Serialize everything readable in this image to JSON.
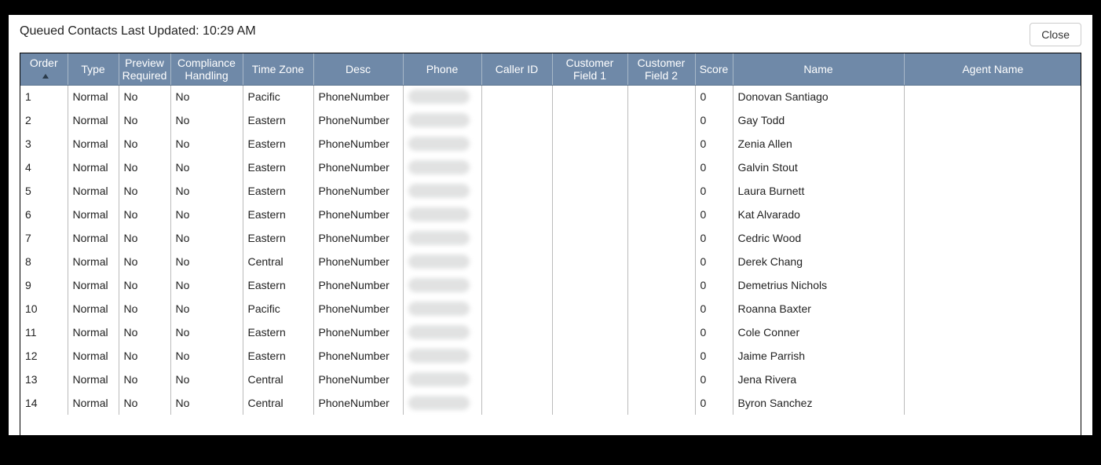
{
  "header": {
    "title": "Queued Contacts Last Updated: 10:29 AM",
    "close_label": "Close"
  },
  "columns": {
    "order": "Order",
    "type": "Type",
    "preview_required": "Preview Required",
    "compliance_handling": "Compliance Handling",
    "time_zone": "Time Zone",
    "desc": "Desc",
    "phone": "Phone",
    "caller_id": "Caller ID",
    "customer_field_1": "Customer Field 1",
    "customer_field_2": "Customer Field 2",
    "score": "Score",
    "name": "Name",
    "agent_name": "Agent Name"
  },
  "sort": {
    "column": "order",
    "direction": "asc"
  },
  "rows": [
    {
      "order": "1",
      "type": "Normal",
      "preview_required": "No",
      "compliance_handling": "No",
      "time_zone": "Pacific",
      "desc": "PhoneNumber",
      "phone": "",
      "caller_id": "",
      "cf1": "",
      "cf2": "",
      "score": "0",
      "name": "Donovan Santiago",
      "agent_name": ""
    },
    {
      "order": "2",
      "type": "Normal",
      "preview_required": "No",
      "compliance_handling": "No",
      "time_zone": "Eastern",
      "desc": "PhoneNumber",
      "phone": "",
      "caller_id": "",
      "cf1": "",
      "cf2": "",
      "score": "0",
      "name": "Gay Todd",
      "agent_name": ""
    },
    {
      "order": "3",
      "type": "Normal",
      "preview_required": "No",
      "compliance_handling": "No",
      "time_zone": "Eastern",
      "desc": "PhoneNumber",
      "phone": "",
      "caller_id": "",
      "cf1": "",
      "cf2": "",
      "score": "0",
      "name": "Zenia Allen",
      "agent_name": ""
    },
    {
      "order": "4",
      "type": "Normal",
      "preview_required": "No",
      "compliance_handling": "No",
      "time_zone": "Eastern",
      "desc": "PhoneNumber",
      "phone": "",
      "caller_id": "",
      "cf1": "",
      "cf2": "",
      "score": "0",
      "name": "Galvin Stout",
      "agent_name": ""
    },
    {
      "order": "5",
      "type": "Normal",
      "preview_required": "No",
      "compliance_handling": "No",
      "time_zone": "Eastern",
      "desc": "PhoneNumber",
      "phone": "",
      "caller_id": "",
      "cf1": "",
      "cf2": "",
      "score": "0",
      "name": "Laura Burnett",
      "agent_name": ""
    },
    {
      "order": "6",
      "type": "Normal",
      "preview_required": "No",
      "compliance_handling": "No",
      "time_zone": "Eastern",
      "desc": "PhoneNumber",
      "phone": "",
      "caller_id": "",
      "cf1": "",
      "cf2": "",
      "score": "0",
      "name": "Kat Alvarado",
      "agent_name": ""
    },
    {
      "order": "7",
      "type": "Normal",
      "preview_required": "No",
      "compliance_handling": "No",
      "time_zone": "Eastern",
      "desc": "PhoneNumber",
      "phone": "",
      "caller_id": "",
      "cf1": "",
      "cf2": "",
      "score": "0",
      "name": "Cedric Wood",
      "agent_name": ""
    },
    {
      "order": "8",
      "type": "Normal",
      "preview_required": "No",
      "compliance_handling": "No",
      "time_zone": "Central",
      "desc": "PhoneNumber",
      "phone": "",
      "caller_id": "",
      "cf1": "",
      "cf2": "",
      "score": "0",
      "name": "Derek Chang",
      "agent_name": ""
    },
    {
      "order": "9",
      "type": "Normal",
      "preview_required": "No",
      "compliance_handling": "No",
      "time_zone": "Eastern",
      "desc": "PhoneNumber",
      "phone": "",
      "caller_id": "",
      "cf1": "",
      "cf2": "",
      "score": "0",
      "name": "Demetrius Nichols",
      "agent_name": ""
    },
    {
      "order": "10",
      "type": "Normal",
      "preview_required": "No",
      "compliance_handling": "No",
      "time_zone": "Pacific",
      "desc": "PhoneNumber",
      "phone": "",
      "caller_id": "",
      "cf1": "",
      "cf2": "",
      "score": "0",
      "name": "Roanna Baxter",
      "agent_name": ""
    },
    {
      "order": "11",
      "type": "Normal",
      "preview_required": "No",
      "compliance_handling": "No",
      "time_zone": "Eastern",
      "desc": "PhoneNumber",
      "phone": "",
      "caller_id": "",
      "cf1": "",
      "cf2": "",
      "score": "0",
      "name": "Cole Conner",
      "agent_name": ""
    },
    {
      "order": "12",
      "type": "Normal",
      "preview_required": "No",
      "compliance_handling": "No",
      "time_zone": "Eastern",
      "desc": "PhoneNumber",
      "phone": "",
      "caller_id": "",
      "cf1": "",
      "cf2": "",
      "score": "0",
      "name": "Jaime Parrish",
      "agent_name": ""
    },
    {
      "order": "13",
      "type": "Normal",
      "preview_required": "No",
      "compliance_handling": "No",
      "time_zone": "Central",
      "desc": "PhoneNumber",
      "phone": "",
      "caller_id": "",
      "cf1": "",
      "cf2": "",
      "score": "0",
      "name": "Jena Rivera",
      "agent_name": ""
    },
    {
      "order": "14",
      "type": "Normal",
      "preview_required": "No",
      "compliance_handling": "No",
      "time_zone": "Central",
      "desc": "PhoneNumber",
      "phone": "",
      "caller_id": "",
      "cf1": "",
      "cf2": "",
      "score": "0",
      "name": "Byron Sanchez",
      "agent_name": ""
    }
  ]
}
